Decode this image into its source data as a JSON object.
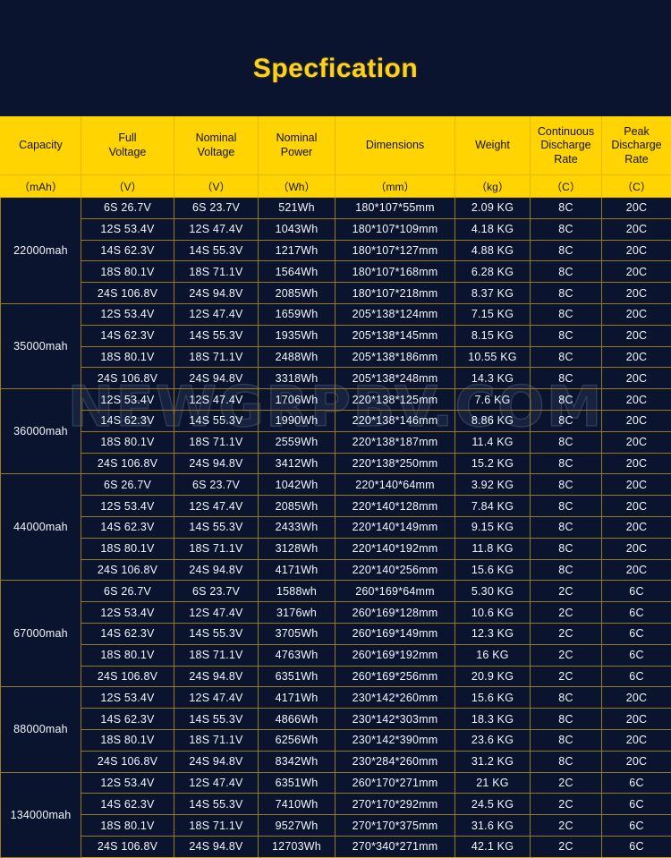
{
  "title": "Specfication",
  "watermark": "NEWGRPBV.COM",
  "colors": {
    "background": "#0a142e",
    "accent": "#ffd400",
    "title": "#ffd11a",
    "border": "#9a7a20",
    "text": "#f2f5fb"
  },
  "table": {
    "headers": [
      {
        "label": "Capacity",
        "unit": "（mAh）"
      },
      {
        "label": "Full\nVoltage",
        "line1": "Full",
        "line2": "Voltage",
        "unit": "（V）"
      },
      {
        "label": "Nominal\nVoltage",
        "line1": "Nominal",
        "line2": "Voltage",
        "unit": "（V）"
      },
      {
        "label": "Nominal\nPower",
        "line1": "Nominal",
        "line2": "Power",
        "unit": "（Wh）"
      },
      {
        "label": "Dimensions",
        "unit": "（mm）"
      },
      {
        "label": "Weight",
        "unit": "（kg）"
      },
      {
        "label": "Continuous Discharge Rate",
        "line1": "Continuous",
        "line2": "Discharge",
        "line3": "Rate",
        "unit": "（C）"
      },
      {
        "label": "Peak Discharge Rate",
        "line1": "Peak",
        "line2": "Discharge",
        "line3": "Rate",
        "unit": "（C）"
      }
    ],
    "groups": [
      {
        "capacity": "22000mah",
        "rows": [
          {
            "full_voltage": "6S  26.7V",
            "nominal_voltage": "6S  23.7V",
            "nominal_power": "521Wh",
            "dimensions": "180*107*55mm",
            "weight": "2.09 KG",
            "continuous_rate": "8C",
            "peak_rate": "20C"
          },
          {
            "full_voltage": "12S  53.4V",
            "nominal_voltage": "12S  47.4V",
            "nominal_power": "1043Wh",
            "dimensions": "180*107*109mm",
            "weight": "4.18 KG",
            "continuous_rate": "8C",
            "peak_rate": "20C"
          },
          {
            "full_voltage": "14S  62.3V",
            "nominal_voltage": "14S  55.3V",
            "nominal_power": "1217Wh",
            "dimensions": "180*107*127mm",
            "weight": "4.88 KG",
            "continuous_rate": "8C",
            "peak_rate": "20C"
          },
          {
            "full_voltage": "18S  80.1V",
            "nominal_voltage": "18S  71.1V",
            "nominal_power": "1564Wh",
            "dimensions": "180*107*168mm",
            "weight": "6.28 KG",
            "continuous_rate": "8C",
            "peak_rate": "20C"
          },
          {
            "full_voltage": "24S  106.8V",
            "nominal_voltage": "24S  94.8V",
            "nominal_power": "2085Wh",
            "dimensions": "180*107*218mm",
            "weight": "8.37 KG",
            "continuous_rate": "8C",
            "peak_rate": "20C"
          }
        ]
      },
      {
        "capacity": "35000mah",
        "rows": [
          {
            "full_voltage": "12S  53.4V",
            "nominal_voltage": "12S  47.4V",
            "nominal_power": "1659Wh",
            "dimensions": "205*138*124mm",
            "weight": "7.15 KG",
            "continuous_rate": "8C",
            "peak_rate": "20C"
          },
          {
            "full_voltage": "14S  62.3V",
            "nominal_voltage": "14S  55.3V",
            "nominal_power": "1935Wh",
            "dimensions": "205*138*145mm",
            "weight": "8.15 KG",
            "continuous_rate": "8C",
            "peak_rate": "20C"
          },
          {
            "full_voltage": "18S  80.1V",
            "nominal_voltage": "18S  71.1V",
            "nominal_power": "2488Wh",
            "dimensions": "205*138*186mm",
            "weight": "10.55 KG",
            "continuous_rate": "8C",
            "peak_rate": "20C"
          },
          {
            "full_voltage": "24S  106.8V",
            "nominal_voltage": "24S  94.8V",
            "nominal_power": "3318Wh",
            "dimensions": "205*138*248mm",
            "weight": "14.3 KG",
            "continuous_rate": "8C",
            "peak_rate": "20C"
          }
        ]
      },
      {
        "capacity": "36000mah",
        "rows": [
          {
            "full_voltage": "12S  53.4V",
            "nominal_voltage": "12S  47.4V",
            "nominal_power": "1706Wh",
            "dimensions": "220*138*125mm",
            "weight": "7.6 KG",
            "continuous_rate": "8C",
            "peak_rate": "20C"
          },
          {
            "full_voltage": "14S  62.3V",
            "nominal_voltage": "14S  55.3V",
            "nominal_power": "1990Wh",
            "dimensions": "220*138*146mm",
            "weight": "8.86 KG",
            "continuous_rate": "8C",
            "peak_rate": "20C"
          },
          {
            "full_voltage": "18S  80.1V",
            "nominal_voltage": "18S  71.1V",
            "nominal_power": "2559Wh",
            "dimensions": "220*138*187mm",
            "weight": "11.4 KG",
            "continuous_rate": "8C",
            "peak_rate": "20C"
          },
          {
            "full_voltage": "24S  106.8V",
            "nominal_voltage": "24S  94.8V",
            "nominal_power": "3412Wh",
            "dimensions": "220*138*250mm",
            "weight": "15.2 KG",
            "continuous_rate": "8C",
            "peak_rate": "20C"
          }
        ]
      },
      {
        "capacity": "44000mah",
        "rows": [
          {
            "full_voltage": "6S  26.7V",
            "nominal_voltage": "6S  23.7V",
            "nominal_power": "1042Wh",
            "dimensions": "220*140*64mm",
            "weight": "3.92 KG",
            "continuous_rate": "8C",
            "peak_rate": "20C"
          },
          {
            "full_voltage": "12S  53.4V",
            "nominal_voltage": "12S  47.4V",
            "nominal_power": "2085Wh",
            "dimensions": "220*140*128mm",
            "weight": "7.84 KG",
            "continuous_rate": "8C",
            "peak_rate": "20C"
          },
          {
            "full_voltage": "14S  62.3V",
            "nominal_voltage": "14S  55.3V",
            "nominal_power": "2433Wh",
            "dimensions": "220*140*149mm",
            "weight": "9.15 KG",
            "continuous_rate": "8C",
            "peak_rate": "20C"
          },
          {
            "full_voltage": "18S  80.1V",
            "nominal_voltage": "18S  71.1V",
            "nominal_power": "3128Wh",
            "dimensions": "220*140*192mm",
            "weight": "11.8 KG",
            "continuous_rate": "8C",
            "peak_rate": "20C"
          },
          {
            "full_voltage": "24S  106.8V",
            "nominal_voltage": "24S  94.8V",
            "nominal_power": "4171Wh",
            "dimensions": "220*140*256mm",
            "weight": "15.6 KG",
            "continuous_rate": "8C",
            "peak_rate": "20C"
          }
        ]
      },
      {
        "capacity": "67000mah",
        "rows": [
          {
            "full_voltage": "6S  26.7V",
            "nominal_voltage": "6S  23.7V",
            "nominal_power": "1588wh",
            "dimensions": "260*169*64mm",
            "weight": "5.30 KG",
            "continuous_rate": "2C",
            "peak_rate": "6C"
          },
          {
            "full_voltage": "12S  53.4V",
            "nominal_voltage": "12S  47.4V",
            "nominal_power": "3176wh",
            "dimensions": "260*169*128mm",
            "weight": "10.6 KG",
            "continuous_rate": "2C",
            "peak_rate": "6C"
          },
          {
            "full_voltage": "14S  62.3V",
            "nominal_voltage": "14S  55.3V",
            "nominal_power": "3705Wh",
            "dimensions": "260*169*149mm",
            "weight": "12.3 KG",
            "continuous_rate": "2C",
            "peak_rate": "6C"
          },
          {
            "full_voltage": "18S  80.1V",
            "nominal_voltage": "18S  71.1V",
            "nominal_power": "4763Wh",
            "dimensions": "260*169*192mm",
            "weight": "16 KG",
            "continuous_rate": "2C",
            "peak_rate": "6C"
          },
          {
            "full_voltage": "24S  106.8V",
            "nominal_voltage": "24S  94.8V",
            "nominal_power": "6351Wh",
            "dimensions": "260*169*256mm",
            "weight": "20.9 KG",
            "continuous_rate": "2C",
            "peak_rate": "6C"
          }
        ]
      },
      {
        "capacity": "88000mah",
        "rows": [
          {
            "full_voltage": "12S  53.4V",
            "nominal_voltage": "12S  47.4V",
            "nominal_power": "4171Wh",
            "dimensions": "230*142*260mm",
            "weight": "15.6 KG",
            "continuous_rate": "8C",
            "peak_rate": "20C"
          },
          {
            "full_voltage": "14S  62.3V",
            "nominal_voltage": "14S  55.3V",
            "nominal_power": "4866Wh",
            "dimensions": "230*142*303mm",
            "weight": "18.3 KG",
            "continuous_rate": "8C",
            "peak_rate": "20C"
          },
          {
            "full_voltage": "18S  80.1V",
            "nominal_voltage": "18S  71.1V",
            "nominal_power": "6256Wh",
            "dimensions": "230*142*390mm",
            "weight": "23.6 KG",
            "continuous_rate": "8C",
            "peak_rate": "20C"
          },
          {
            "full_voltage": "24S  106.8V",
            "nominal_voltage": "24S  94.8V",
            "nominal_power": "8342Wh",
            "dimensions": "230*284*260mm",
            "weight": "31.2 KG",
            "continuous_rate": "8C",
            "peak_rate": "20C"
          }
        ]
      },
      {
        "capacity": "134000mah",
        "rows": [
          {
            "full_voltage": "12S  53.4V",
            "nominal_voltage": "12S  47.4V",
            "nominal_power": "6351Wh",
            "dimensions": "260*170*271mm",
            "weight": "21 KG",
            "continuous_rate": "2C",
            "peak_rate": "6C"
          },
          {
            "full_voltage": "14S  62.3V",
            "nominal_voltage": "14S  55.3V",
            "nominal_power": "7410Wh",
            "dimensions": "270*170*292mm",
            "weight": "24.5 KG",
            "continuous_rate": "2C",
            "peak_rate": "6C"
          },
          {
            "full_voltage": "18S  80.1V",
            "nominal_voltage": "18S  71.1V",
            "nominal_power": "9527Wh",
            "dimensions": "270*170*375mm",
            "weight": "31.6 KG",
            "continuous_rate": "2C",
            "peak_rate": "6C"
          },
          {
            "full_voltage": "24S  106.8V",
            "nominal_voltage": "24S  94.8V",
            "nominal_power": "12703Wh",
            "dimensions": "270*340*271mm",
            "weight": "42.1 KG",
            "continuous_rate": "2C",
            "peak_rate": "6C"
          }
        ]
      }
    ]
  }
}
